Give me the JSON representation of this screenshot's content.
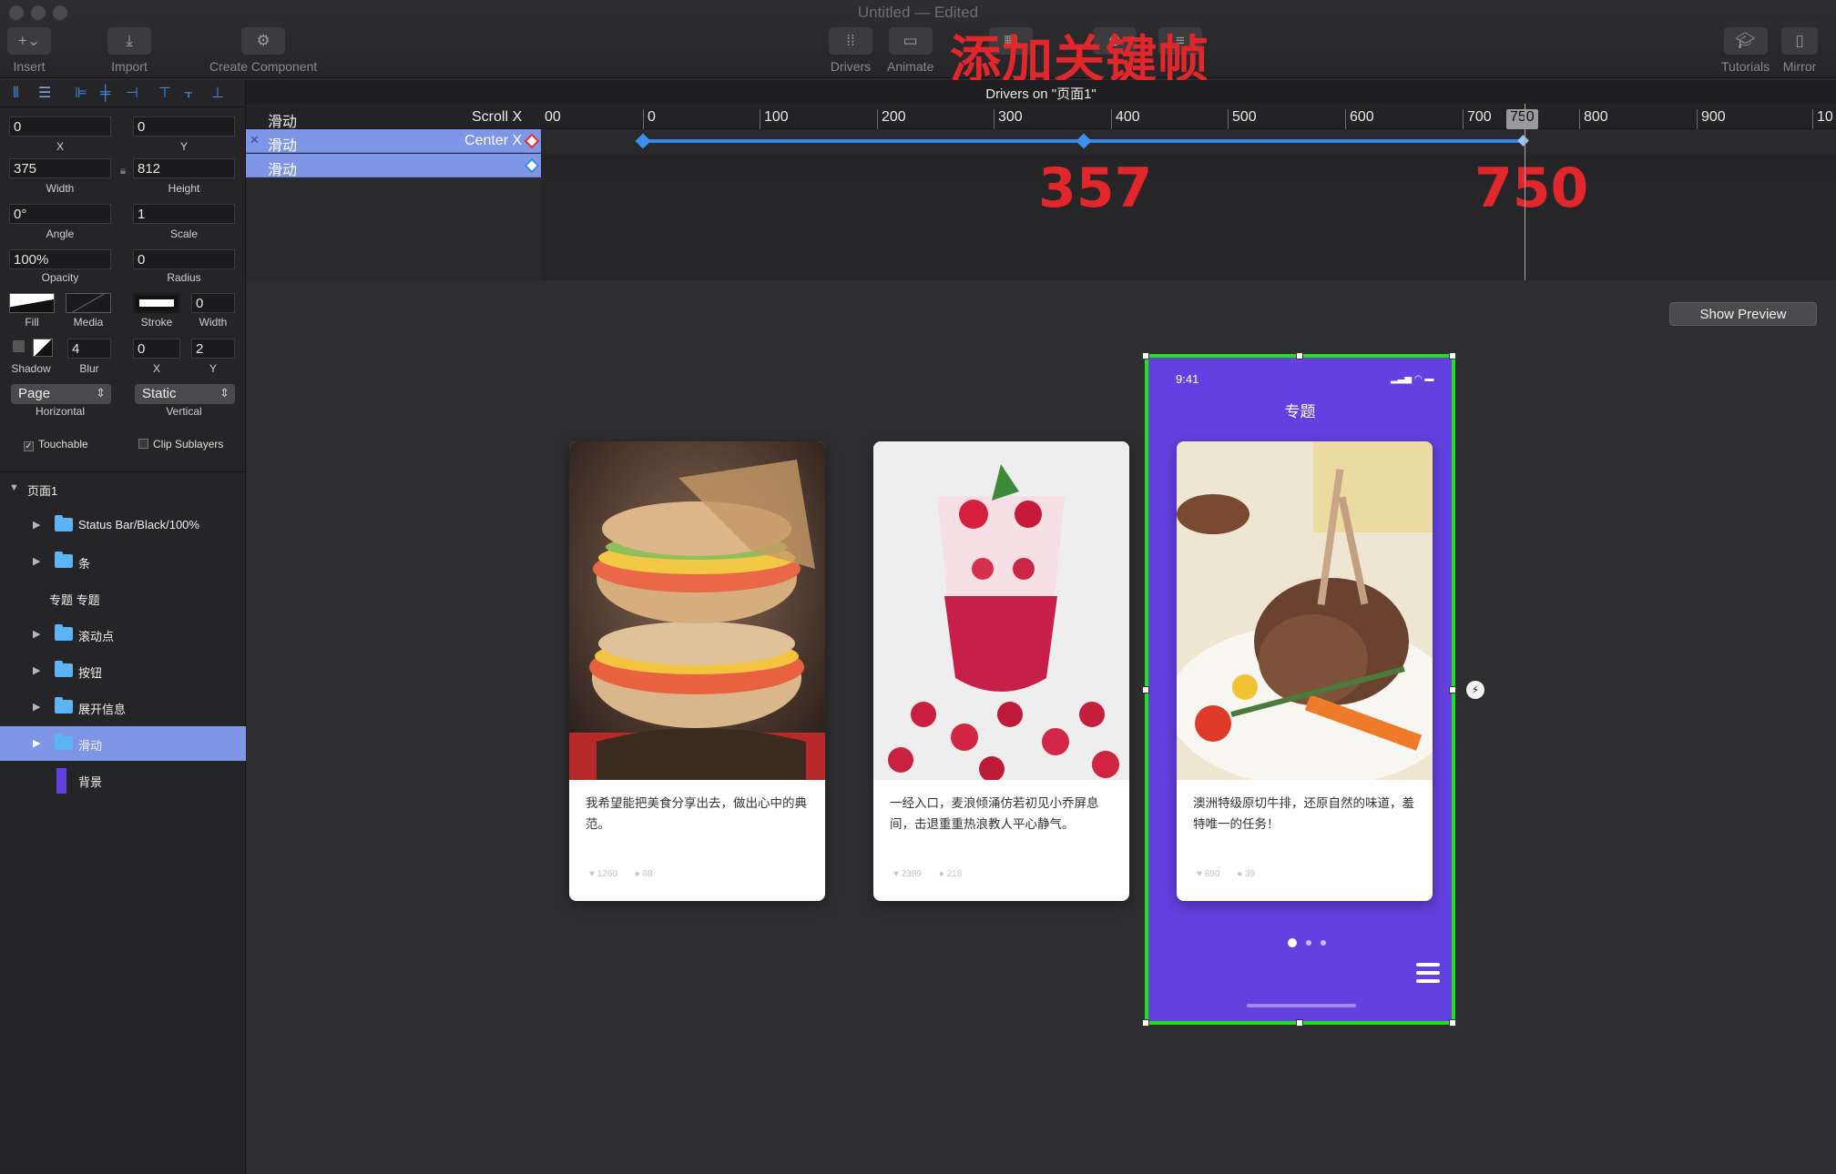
{
  "window": {
    "title": "Untitled — Edited"
  },
  "toolbar": {
    "insert": "Insert",
    "import": "Import",
    "create_component": "Create Component",
    "drivers": "Drivers",
    "animate": "Animate",
    "tutorials": "Tutorials",
    "mirror": "Mirror"
  },
  "annotation": {
    "title": "添加关键帧",
    "num_a": "357",
    "num_b": "750"
  },
  "timeline": {
    "caption": "Drivers on \"页面1\"",
    "driver_layer": "滑动",
    "driver_prop": "Scroll X",
    "ruler": [
      "00",
      "0",
      "100",
      "200",
      "300",
      "400",
      "500",
      "600",
      "700",
      "750",
      "800",
      "900",
      "10"
    ],
    "tracks": [
      {
        "layer": "滑动",
        "prop": "Center X"
      },
      {
        "layer": "滑动",
        "prop": ""
      }
    ]
  },
  "inspector": {
    "x": "0",
    "x_label": "X",
    "y": "0",
    "y_label": "Y",
    "width": "375",
    "width_label": "Width",
    "height": "812",
    "height_label": "Height",
    "angle": "0°",
    "angle_label": "Angle",
    "scale": "1",
    "scale_label": "Scale",
    "opacity": "100%",
    "opacity_label": "Opacity",
    "radius": "0",
    "radius_label": "Radius",
    "fill_label": "Fill",
    "media_label": "Media",
    "stroke_label": "Stroke",
    "stroke_width": "0",
    "stroke_width_label": "Width",
    "shadow_label": "Shadow",
    "blur": "4",
    "blur_label": "Blur",
    "shadow_x": "0",
    "shadow_x_label": "X",
    "shadow_y": "2",
    "shadow_y_label": "Y",
    "horizontal": "Page",
    "horizontal_label": "Horizontal",
    "vertical": "Static",
    "vertical_label": "Vertical",
    "touchable": "Touchable",
    "clip": "Clip Sublayers"
  },
  "layers": [
    {
      "name": "页面1"
    },
    {
      "name": "Status Bar/Black/100%"
    },
    {
      "name": "条"
    },
    {
      "name": "专题 专题"
    },
    {
      "name": "滚动点"
    },
    {
      "name": "按钮"
    },
    {
      "name": "展开信息"
    },
    {
      "name": "滑动"
    },
    {
      "name": "背景"
    }
  ],
  "canvas": {
    "show_preview": "Show Preview",
    "phone": {
      "time": "9:41",
      "title": "专题"
    },
    "cards": [
      {
        "text": "我希望能把美食分享出去，做出心中的典范。",
        "likes": "1260",
        "comments": "88"
      },
      {
        "text": "一经入口，麦浪倾涌仿若初见小乔屏息间，击退重重热浪教人平心静气。",
        "likes": "2389",
        "comments": "218"
      },
      {
        "text": "澳洲特级原切牛排，还原自然的味道，羞特唯一的任务！",
        "likes": "890",
        "comments": "39"
      }
    ]
  },
  "colors": {
    "accent": "#6340e0",
    "selection": "#22e01e",
    "annotation": "#e1262c",
    "keyframe": "#2f86e8"
  }
}
